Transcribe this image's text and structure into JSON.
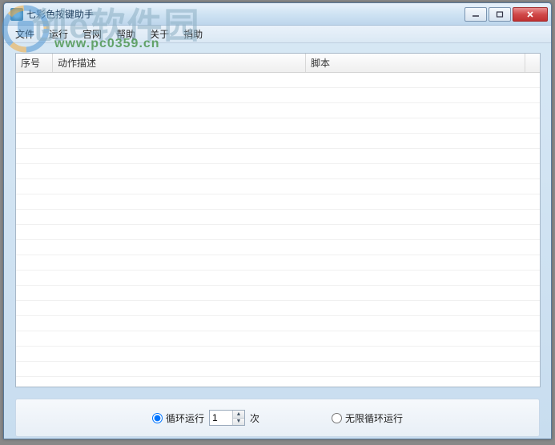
{
  "window": {
    "title": "七彩色按键助手"
  },
  "menu": {
    "file": "文件",
    "run": "运行",
    "official": "官网",
    "help": "帮助",
    "about": "关于",
    "donate": "捐助"
  },
  "columns": {
    "seq": "序号",
    "desc": "动作描述",
    "script": "脚本"
  },
  "rows": [],
  "loop": {
    "finite_label_pre": "循环运行",
    "finite_label_suf": "次",
    "count": "1",
    "infinite_label": "无限循环运行",
    "selected": "finite"
  },
  "watermark": {
    "text": "创e软件园",
    "url": "www.pc0359.cn"
  }
}
